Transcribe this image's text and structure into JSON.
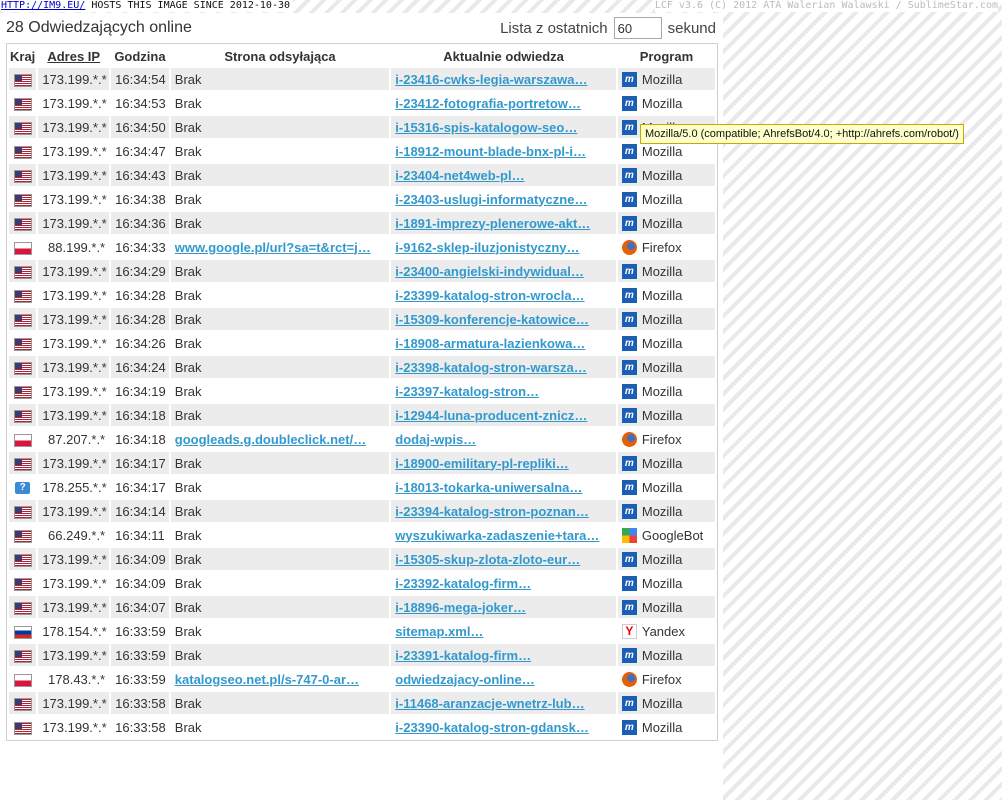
{
  "topbar": {
    "link": "HTTP://IM9.EU/",
    "text": "HOSTS THIS IMAGE SINCE 2012-10-30",
    "credit": "LCF v3.6 (C) 2012 ATA Walerian Walawski / SublimeStar.com"
  },
  "heading": "28 Odwiedzających online",
  "list_control": {
    "label_before": "Lista z ostatnich",
    "value": "60",
    "label_after": "sekund"
  },
  "columns": [
    "Kraj",
    "Adres IP",
    "Godzina",
    "Strona odsyłająca",
    "Aktualnie odwiedza",
    "Program"
  ],
  "rows": [
    {
      "flag": "us",
      "ip": "173.199.*.*",
      "time": "16:34:54",
      "ref": "Brak",
      "ref_link": false,
      "page": "i-23416-cwks-legia-warszawa…",
      "prog": "Mozilla",
      "icon": "ie"
    },
    {
      "flag": "us",
      "ip": "173.199.*.*",
      "time": "16:34:53",
      "ref": "Brak",
      "ref_link": false,
      "page": "i-23412-fotografia-portretow…",
      "prog": "Mozilla",
      "icon": "ie"
    },
    {
      "flag": "us",
      "ip": "173.199.*.*",
      "time": "16:34:50",
      "ref": "Brak",
      "ref_link": false,
      "page": "i-15316-spis-katalogow-seo…",
      "prog": "Mozilla",
      "icon": "ie"
    },
    {
      "flag": "us",
      "ip": "173.199.*.*",
      "time": "16:34:47",
      "ref": "Brak",
      "ref_link": false,
      "page": "i-18912-mount-blade-bnx-pl-i…",
      "prog": "Mozilla",
      "icon": "ie"
    },
    {
      "flag": "us",
      "ip": "173.199.*.*",
      "time": "16:34:43",
      "ref": "Brak",
      "ref_link": false,
      "page": "i-23404-net4web-pl…",
      "prog": "Mozilla",
      "icon": "ie"
    },
    {
      "flag": "us",
      "ip": "173.199.*.*",
      "time": "16:34:38",
      "ref": "Brak",
      "ref_link": false,
      "page": "i-23403-uslugi-informatyczne…",
      "prog": "Mozilla",
      "icon": "ie"
    },
    {
      "flag": "us",
      "ip": "173.199.*.*",
      "time": "16:34:36",
      "ref": "Brak",
      "ref_link": false,
      "page": "i-1891-imprezy-plenerowe-akt…",
      "prog": "Mozilla",
      "icon": "ie"
    },
    {
      "flag": "pl",
      "ip": "88.199.*.*",
      "time": "16:34:33",
      "ref": "www.google.pl/url?sa=t&rct=j…",
      "ref_link": true,
      "page": "i-9162-sklep-iluzjonistyczny…",
      "prog": "Firefox",
      "icon": "ff"
    },
    {
      "flag": "us",
      "ip": "173.199.*.*",
      "time": "16:34:29",
      "ref": "Brak",
      "ref_link": false,
      "page": "i-23400-angielski-indywidual…",
      "prog": "Mozilla",
      "icon": "ie"
    },
    {
      "flag": "us",
      "ip": "173.199.*.*",
      "time": "16:34:28",
      "ref": "Brak",
      "ref_link": false,
      "page": "i-23399-katalog-stron-wrocla…",
      "prog": "Mozilla",
      "icon": "ie"
    },
    {
      "flag": "us",
      "ip": "173.199.*.*",
      "time": "16:34:28",
      "ref": "Brak",
      "ref_link": false,
      "page": "i-15309-konferencje-katowice…",
      "prog": "Mozilla",
      "icon": "ie"
    },
    {
      "flag": "us",
      "ip": "173.199.*.*",
      "time": "16:34:26",
      "ref": "Brak",
      "ref_link": false,
      "page": "i-18908-armatura-lazienkowa…",
      "prog": "Mozilla",
      "icon": "ie"
    },
    {
      "flag": "us",
      "ip": "173.199.*.*",
      "time": "16:34:24",
      "ref": "Brak",
      "ref_link": false,
      "page": "i-23398-katalog-stron-warsza…",
      "prog": "Mozilla",
      "icon": "ie"
    },
    {
      "flag": "us",
      "ip": "173.199.*.*",
      "time": "16:34:19",
      "ref": "Brak",
      "ref_link": false,
      "page": "i-23397-katalog-stron…",
      "prog": "Mozilla",
      "icon": "ie"
    },
    {
      "flag": "us",
      "ip": "173.199.*.*",
      "time": "16:34:18",
      "ref": "Brak",
      "ref_link": false,
      "page": "i-12944-luna-producent-znicz…",
      "prog": "Mozilla",
      "icon": "ie"
    },
    {
      "flag": "pl",
      "ip": "87.207.*.*",
      "time": "16:34:18",
      "ref": "googleads.g.doubleclick.net/…",
      "ref_link": true,
      "page": "dodaj-wpis…",
      "prog": "Firefox",
      "icon": "ff"
    },
    {
      "flag": "us",
      "ip": "173.199.*.*",
      "time": "16:34:17",
      "ref": "Brak",
      "ref_link": false,
      "page": "i-18900-emilitary-pl-repliki…",
      "prog": "Mozilla",
      "icon": "ie"
    },
    {
      "flag": "unk",
      "ip": "178.255.*.*",
      "time": "16:34:17",
      "ref": "Brak",
      "ref_link": false,
      "page": "i-18013-tokarka-uniwersalna…",
      "prog": "Mozilla",
      "icon": "ie"
    },
    {
      "flag": "us",
      "ip": "173.199.*.*",
      "time": "16:34:14",
      "ref": "Brak",
      "ref_link": false,
      "page": "i-23394-katalog-stron-poznan…",
      "prog": "Mozilla",
      "icon": "ie"
    },
    {
      "flag": "us",
      "ip": "66.249.*.*",
      "time": "16:34:11",
      "ref": "Brak",
      "ref_link": false,
      "page": "wyszukiwarka-zadaszenie+tara…",
      "prog": "GoogleBot",
      "icon": "g"
    },
    {
      "flag": "us",
      "ip": "173.199.*.*",
      "time": "16:34:09",
      "ref": "Brak",
      "ref_link": false,
      "page": "i-15305-skup-zlota-zloto-eur…",
      "prog": "Mozilla",
      "icon": "ie"
    },
    {
      "flag": "us",
      "ip": "173.199.*.*",
      "time": "16:34:09",
      "ref": "Brak",
      "ref_link": false,
      "page": "i-23392-katalog-firm…",
      "prog": "Mozilla",
      "icon": "ie"
    },
    {
      "flag": "us",
      "ip": "173.199.*.*",
      "time": "16:34:07",
      "ref": "Brak",
      "ref_link": false,
      "page": "i-18896-mega-joker…",
      "prog": "Mozilla",
      "icon": "ie"
    },
    {
      "flag": "ru",
      "ip": "178.154.*.*",
      "time": "16:33:59",
      "ref": "Brak",
      "ref_link": false,
      "page": "sitemap.xml…",
      "prog": "Yandex",
      "icon": "y"
    },
    {
      "flag": "us",
      "ip": "173.199.*.*",
      "time": "16:33:59",
      "ref": "Brak",
      "ref_link": false,
      "page": "i-23391-katalog-firm…",
      "prog": "Mozilla",
      "icon": "ie"
    },
    {
      "flag": "pl",
      "ip": "178.43.*.*",
      "time": "16:33:59",
      "ref": "katalogseo.net.pl/s-747-0-ar…",
      "ref_link": true,
      "page": "odwiedzajacy-online…",
      "prog": "Firefox",
      "icon": "ff"
    },
    {
      "flag": "us",
      "ip": "173.199.*.*",
      "time": "16:33:58",
      "ref": "Brak",
      "ref_link": false,
      "page": "i-11468-aranzacje-wnetrz-lub…",
      "prog": "Mozilla",
      "icon": "ie"
    },
    {
      "flag": "us",
      "ip": "173.199.*.*",
      "time": "16:33:58",
      "ref": "Brak",
      "ref_link": false,
      "page": "i-23390-katalog-stron-gdansk…",
      "prog": "Mozilla",
      "icon": "ie"
    }
  ],
  "tooltip": "Mozilla/5.0 (compatible; AhrefsBot/4.0; +http://ahrefs.com/robot/)"
}
